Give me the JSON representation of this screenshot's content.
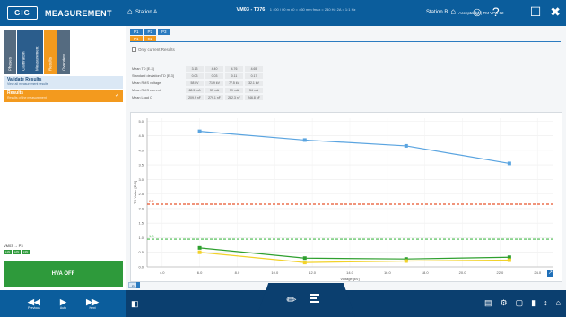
{
  "app": {
    "logo": "GIG",
    "title": "MEASUREMENT"
  },
  "header": {
    "station_a": "Station A",
    "measurement": "VM03 - T076",
    "measurement_sub": "1 : 00 / 00 m   n0 = 460 mm   fmax = 240 Hz   2A = 1:1 Hz",
    "station_b": "Station B",
    "station_b_sub": "Acceptance | TM VPS 62"
  },
  "sidebar": {
    "tabs": [
      "Phases",
      "Calibration",
      "Measurement",
      "Results",
      "Overview"
    ],
    "items": [
      {
        "title": "Validate Results",
        "subtitle": "View all measurement results"
      },
      {
        "title": "Results",
        "subtitle": "Results of the measurement"
      }
    ],
    "status_label": "VM03 → P3",
    "chips": [
      "L1N",
      "L2N",
      "L3N"
    ],
    "hva_button": "HVA OFF"
  },
  "main": {
    "phase_tabs": [
      "P1",
      "P2",
      "P3"
    ],
    "sub_tabs": [
      "P1",
      "C2"
    ],
    "checkbox_label": "Only current Results",
    "stats": [
      {
        "label": "Mean TD [E-3]",
        "values": [
          "3.13",
          "4.40",
          "4.76",
          "4.65"
        ]
      },
      {
        "label": "Standard deviation TD [E-3]",
        "values": [
          "0.03",
          "0.03",
          "0.11",
          "0.17"
        ]
      },
      {
        "label": "Mean RMS voltage",
        "values": [
          "58 kV",
          "71.9 kV",
          "77.5 kV",
          "32.1 kV"
        ]
      },
      {
        "label": "Mean RMS current",
        "values": [
          "68.5 mA",
          "57 mA",
          "59 mA",
          "54 mA"
        ]
      },
      {
        "label": "Mean Load C",
        "values": [
          "209.9 nF",
          "279.1 nF",
          "282.3 nF",
          "246.8 nF"
        ]
      }
    ],
    "bottom_tab": "P1"
  },
  "chart_data": {
    "type": "line",
    "xlabel": "Voltage [kV]",
    "ylabel": "TD Value [E-3]",
    "x_ticks": [
      "4.0",
      "6.0",
      "8.0",
      "10.0",
      "12.0",
      "14.0",
      "16.0",
      "18.0",
      "20.0",
      "22.0",
      "24.0"
    ],
    "y_ticks": [
      "0.0",
      "0.5",
      "1.0",
      "1.5",
      "2.0",
      "2.5",
      "3.0",
      "3.5",
      "4.0",
      "4.5",
      "5.0"
    ],
    "xlim": [
      3.2,
      24.8
    ],
    "ylim": [
      0,
      5.1
    ],
    "series": [
      {
        "x": [
          6.0,
          11.6,
          17.0,
          22.5
        ],
        "values": [
          4.65,
          4.35,
          4.15,
          3.55
        ],
        "color": "#5aa4e0"
      },
      {
        "x": [
          6.0,
          11.6,
          17.0,
          22.5
        ],
        "values": [
          0.65,
          0.3,
          0.27,
          0.33
        ],
        "color": "#2fa02f"
      },
      {
        "x": [
          6.0,
          11.6,
          17.0,
          22.5
        ],
        "values": [
          0.5,
          0.15,
          0.2,
          0.23
        ],
        "color": "#f2d22a"
      }
    ],
    "thresholds": [
      {
        "value": 2.15,
        "label": "2.2",
        "color": "#e8542c"
      },
      {
        "value": 0.95,
        "label": "1.0",
        "color": "#45b84a"
      }
    ],
    "grid": true
  },
  "colors": {
    "primary": "#0b5d9c",
    "accent": "#f39a1e",
    "ok": "#2e9a3b"
  }
}
